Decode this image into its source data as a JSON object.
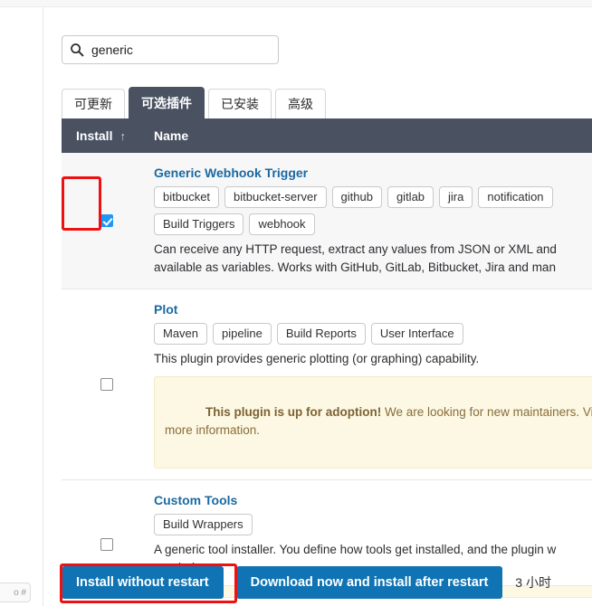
{
  "search": {
    "value": "generic",
    "placeholder": "",
    "icon": "search-icon"
  },
  "tabs": [
    {
      "label": "可更新",
      "active": false
    },
    {
      "label": "可选插件",
      "active": true
    },
    {
      "label": "已安装",
      "active": false
    },
    {
      "label": "高级",
      "active": false
    }
  ],
  "table": {
    "columns": {
      "install": "Install",
      "install_sort_icon": "↑",
      "name": "Name"
    },
    "rows": [
      {
        "name": "Generic Webhook Trigger",
        "checked": true,
        "shaded": true,
        "labels": [
          "bitbucket",
          "bitbucket-server",
          "github",
          "gitlab",
          "jira",
          "notification"
        ],
        "labels_row2": [
          "Build Triggers",
          "webhook"
        ],
        "excerpt": "Can receive any HTTP request, extract any values from JSON or XML and\navailable as variables. Works with GitHub, GitLab, Bitbucket, Jira and man",
        "adoption": null
      },
      {
        "name": "Plot",
        "checked": false,
        "shaded": false,
        "labels": [
          "Maven",
          "pipeline",
          "Build Reports",
          "User Interface"
        ],
        "labels_row2": [],
        "excerpt": "This plugin provides generic plotting (or graphing) capability.",
        "adoption": {
          "bold": "This plugin is up for adoption!",
          "rest": " We are looking for new maintainers. Vis\nmore information."
        }
      },
      {
        "name": "Custom Tools",
        "checked": false,
        "shaded": false,
        "labels": [
          "Build Wrappers"
        ],
        "labels_row2": [],
        "excerpt": "A generic tool installer. You define how tools get installed, and the plugin w\nneeded.",
        "adoption_stub": true
      }
    ]
  },
  "actions": {
    "install_without_restart": "Install without restart",
    "download_now": "Download now and install after restart",
    "eta": "3 小时"
  },
  "rail": {
    "chip": "o #"
  },
  "colors": {
    "header_bg": "#4a5262",
    "link": "#1a6aa2",
    "primary_button": "#1074b4",
    "checkbox_checked": "#2196f3",
    "annotation": "#ee1111",
    "notice_bg": "#fcf8e3"
  }
}
